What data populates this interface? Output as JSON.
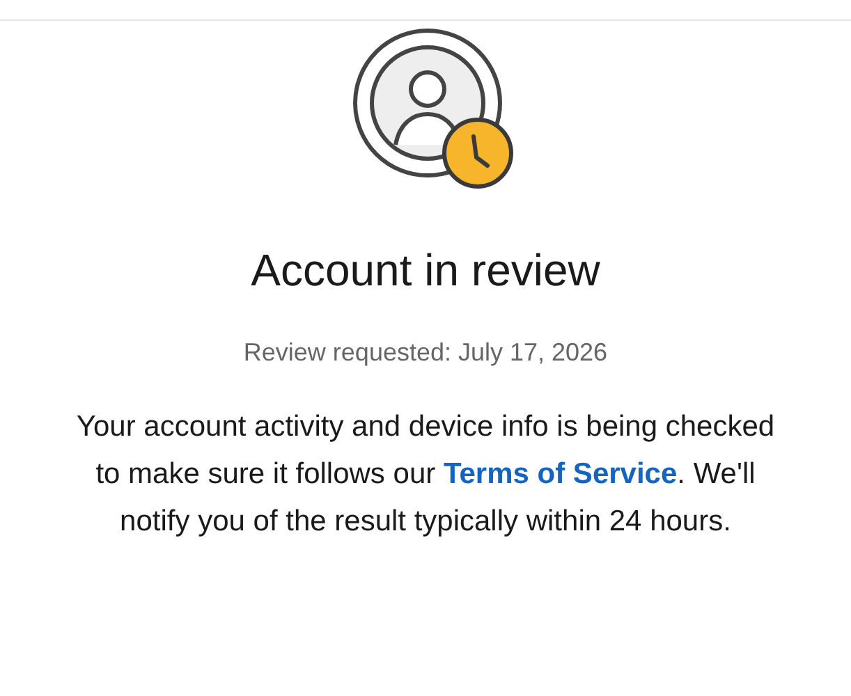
{
  "title": "Account in review",
  "subtitle": "Review requested: July 17, 2026",
  "message": {
    "before": "Your account activity and device info is being checked to make sure it follows our",
    "link": "Terms of Service",
    "after": ". We'll notify you of the result typically within 24 hours."
  }
}
